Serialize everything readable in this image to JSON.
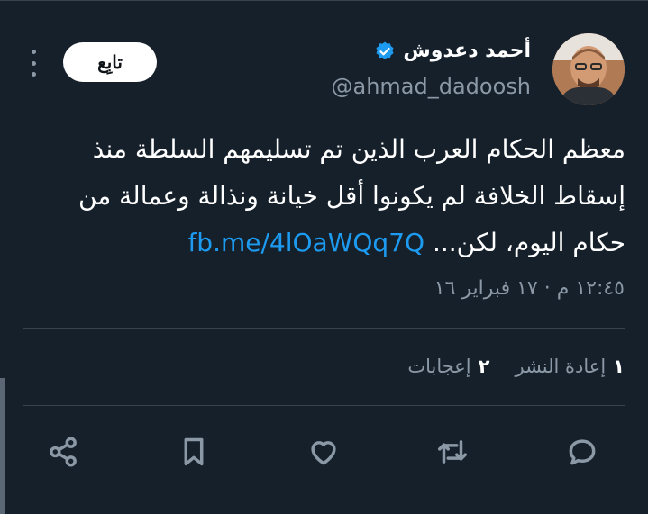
{
  "author": {
    "name": "أحمد دعدوش",
    "handle": "@ahmad_dadoosh",
    "verified": true
  },
  "follow_label": "تابِع",
  "tweet": {
    "text": "معظم الحكام العرب الذين تم تسليمهم السلطة منذ إسقاط الخلافة لم يكونوا أقل خيانة ونذالة وعمالة من حكام اليوم، لكن...",
    "link": "fb.me/4lOaWQq7Q"
  },
  "timestamp": "١٢:٤٥ م · ١٧ فبراير ١٦",
  "stats": {
    "retweets_count": "١",
    "retweets_label": "إعادة النشر",
    "likes_count": "٢",
    "likes_label": "إعجابات"
  },
  "actions": [
    "reply-icon",
    "retweet-icon",
    "like-icon",
    "bookmark-icon",
    "share-icon"
  ],
  "colors": {
    "background": "#15202b",
    "accent": "#1d9bf0",
    "muted": "#8b98a5"
  }
}
